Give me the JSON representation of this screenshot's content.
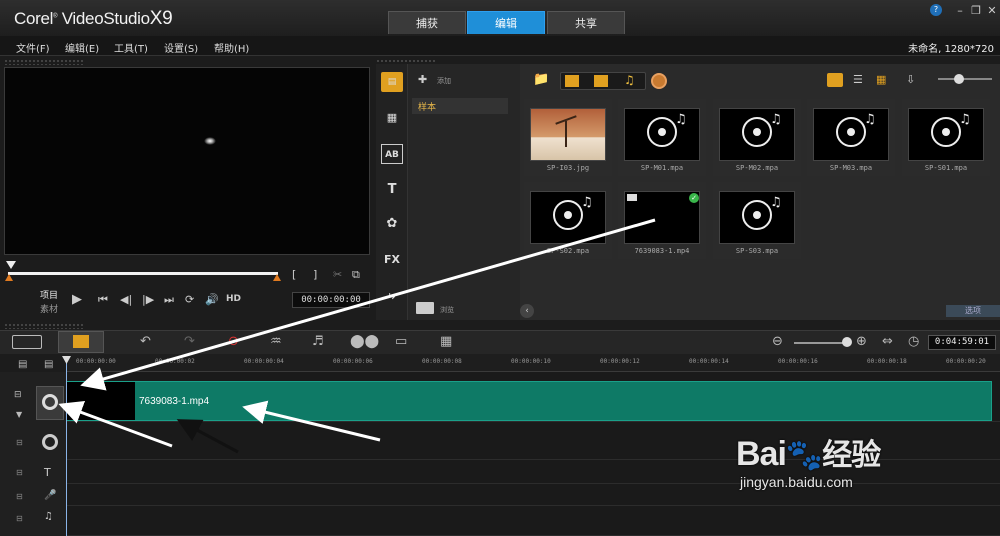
{
  "app": {
    "title_prefix": "Corel",
    "title_main": "VideoStudio",
    "title_suffix": "X9"
  },
  "tabs": [
    {
      "label": "捕获"
    },
    {
      "label": "编辑"
    },
    {
      "label": "共享"
    }
  ],
  "window_buttons": {
    "help": "?",
    "minimize": "–",
    "restore": "❐",
    "close": "✕"
  },
  "menu": [
    "文件(F)",
    "编辑(E)",
    "工具(T)",
    "设置(S)",
    "帮助(H)"
  ],
  "project_info": "未命名, 1280*720",
  "player": {
    "mode_project": "项目",
    "mode_clip": "素材",
    "hd": "HD",
    "timecode": "00:00:00:00",
    "mark_in": "[",
    "mark_out": "]"
  },
  "library": {
    "add_label": "添加",
    "folder": "样本",
    "browse_label": "浏览",
    "options_label": "选项",
    "items": [
      {
        "name": "SP-I03.jpg",
        "kind": "image"
      },
      {
        "name": "SP-M01.mpa",
        "kind": "audio"
      },
      {
        "name": "SP-M02.mpa",
        "kind": "audio"
      },
      {
        "name": "SP-M03.mpa",
        "kind": "audio"
      },
      {
        "name": "SP-S01.mpa",
        "kind": "audio"
      },
      {
        "name": "SP-S02.mpa",
        "kind": "audio"
      },
      {
        "name": "7639083-1.mp4",
        "kind": "video"
      },
      {
        "name": "SP-S03.mpa",
        "kind": "audio"
      }
    ]
  },
  "timeline": {
    "total_time": "0:04:59:01",
    "ruler": [
      "00:00:00:00",
      "00:00:00:02",
      "00:00:00:04",
      "00:00:00:06",
      "00:00:00:08",
      "00:00:00:10",
      "00:00:00:12",
      "00:00:00:14",
      "00:00:00:16",
      "00:00:00:18",
      "00:00:00:20"
    ],
    "clip_name": "7639083-1.mp4"
  },
  "watermark": {
    "brand": "Bai",
    "brand2": "经验",
    "url": "jingyan.baidu.com"
  }
}
